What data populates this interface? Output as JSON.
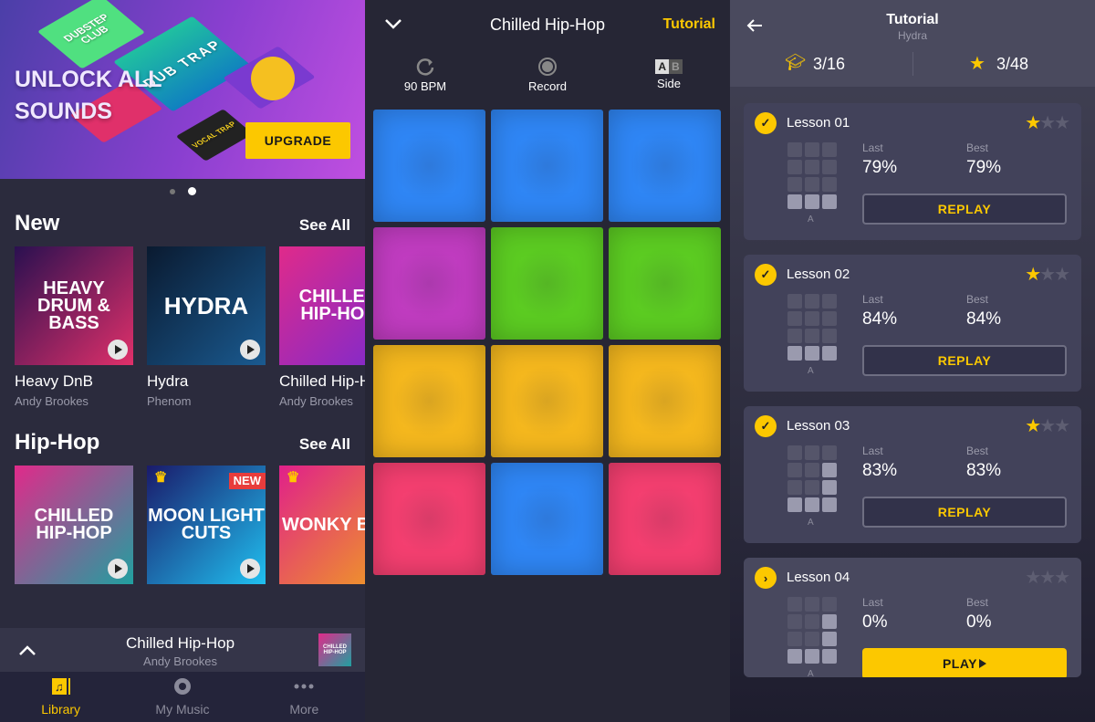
{
  "library": {
    "banner": {
      "title_line1": "UNLOCK ALL",
      "title_line2": "SOUNDS",
      "button": "UPGRADE",
      "art_labels": [
        "DUBSTEP CLUB",
        "DUB TRAP",
        "VOCAL TRAP"
      ]
    },
    "carousel": {
      "pages": 2,
      "active": 2
    },
    "sections": [
      {
        "title": "New",
        "see_all": "See All",
        "albums": [
          {
            "title": "Heavy DnB",
            "artist": "Andy Brookes",
            "art": "HEAVY DRUM & BASS",
            "colors": [
              "#2a1050",
              "#e0306a"
            ]
          },
          {
            "title": "Hydra",
            "artist": "Phenom",
            "art": "HYDRA",
            "colors": [
              "#0a1a30",
              "#1a5a90"
            ]
          },
          {
            "title": "Chilled Hip-Hop",
            "artist": "Andy Brookes",
            "art": "CHILLED HIP-HOP",
            "colors": [
              "#e02a8a",
              "#7a2ad0"
            ]
          }
        ]
      },
      {
        "title": "Hip-Hop",
        "see_all": "See All",
        "albums": [
          {
            "art": "CHILLED HIP-HOP",
            "colors": [
              "#e02a8a",
              "#20a0a0"
            ],
            "crown": false,
            "badge": ""
          },
          {
            "art": "MOON LIGHT CUTS",
            "colors": [
              "#1a1a6a",
              "#20c0f0"
            ],
            "crown": true,
            "badge": "NEW"
          },
          {
            "art": "WONKY BEA",
            "colors": [
              "#e0208a",
              "#f0a020"
            ],
            "crown": true,
            "badge": ""
          }
        ]
      }
    ],
    "mini_player": {
      "title": "Chilled Hip-Hop",
      "artist": "Andy Brookes",
      "thumb": "CHILLED HIP-HOP"
    },
    "nav": [
      {
        "label": "Library",
        "icon": "music-note-icon",
        "active": true
      },
      {
        "label": "My Music",
        "icon": "disc-icon",
        "active": false
      },
      {
        "label": "More",
        "icon": "more-dots-icon",
        "active": false
      }
    ]
  },
  "pads_screen": {
    "title": "Chilled Hip-Hop",
    "tutorial": "Tutorial",
    "tools": [
      {
        "label": "90 BPM",
        "icon": "refresh-icon"
      },
      {
        "label": "Record",
        "icon": "record-icon"
      },
      {
        "label": "Side",
        "icon": "ab-icon",
        "a": "A",
        "b": "B"
      }
    ],
    "pads": [
      "#2f86f5",
      "#2f86f5",
      "#2f86f5",
      "#c03cc0",
      "#5ccc22",
      "#5ccc22",
      "#f5b81e",
      "#f5b81e",
      "#f5b81e",
      "#f43f70",
      "#2f86f5",
      "#f43f70"
    ]
  },
  "tutorial": {
    "title": "Tutorial",
    "subtitle": "Hydra",
    "lessons_progress": "3/16",
    "stars_progress": "3/48",
    "last_label": "Last",
    "best_label": "Best",
    "grid_label": "A",
    "lessons": [
      {
        "name": "Lesson 01",
        "status": "done",
        "stars": 1,
        "last": "79%",
        "best": "79%",
        "button": "REPLAY",
        "lit": [
          9,
          10,
          11
        ]
      },
      {
        "name": "Lesson 02",
        "status": "done",
        "stars": 1,
        "last": "84%",
        "best": "84%",
        "button": "REPLAY",
        "lit": [
          9,
          10,
          11
        ]
      },
      {
        "name": "Lesson 03",
        "status": "done",
        "stars": 1,
        "last": "83%",
        "best": "83%",
        "button": "REPLAY",
        "lit": [
          5,
          8,
          9,
          10,
          11
        ]
      },
      {
        "name": "Lesson 04",
        "status": "next",
        "stars": 0,
        "last": "0%",
        "best": "0%",
        "button": "PLAY",
        "lit": [
          5,
          8,
          9,
          10,
          11
        ]
      }
    ]
  },
  "accent": "#fcc800"
}
